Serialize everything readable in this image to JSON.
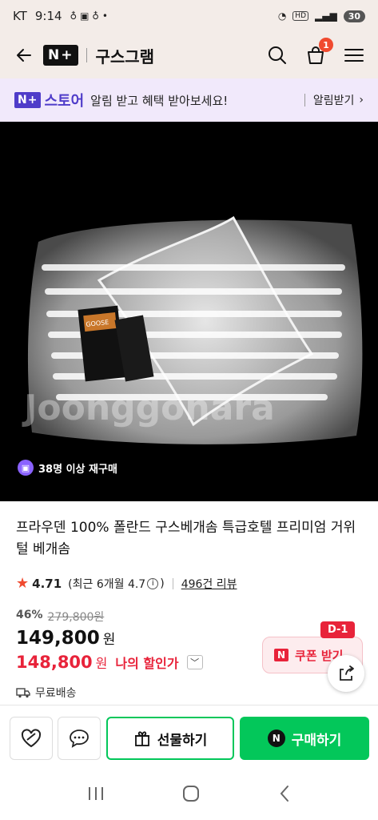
{
  "status_bar": {
    "carrier": "KT",
    "time": "9:14",
    "battery": "30"
  },
  "header": {
    "logo": "N+",
    "title": "구스그램",
    "cart_count": "1"
  },
  "notice": {
    "logo_mark": "N+",
    "logo_text": "스토어",
    "message": "알림 받고 혜택 받아보세요!",
    "action_label": "알림받기",
    "action_chevron": "›"
  },
  "hero": {
    "rebuy_text": "38명 이상 재구매",
    "watermark": "Joonggonara"
  },
  "product": {
    "title": "프라우덴 100% 폴란드 구스베개솜 특급호텔 프리미엄 거위털 베개솜",
    "rating": "4.71",
    "recent_rating_prefix": "(최근 6개월 4.7",
    "recent_rating_suffix": ")",
    "review_count": "496건 리뷰",
    "discount_pct": "46%",
    "original_price": "279,800원",
    "price": "149,800",
    "price_unit": "원",
    "my_discount_price": "148,800",
    "my_discount_unit": "원",
    "my_discount_label": "나의 할인가",
    "shipping": "무료배송"
  },
  "coupon": {
    "d_day": "D-1",
    "mark": "N",
    "label": "쿠폰 받기"
  },
  "actions": {
    "gift_label": "선물하기",
    "buy_label": "구매하기",
    "buy_mark": "N"
  },
  "colors": {
    "naver_green": "#03c75a",
    "accent_red": "#e8233a",
    "store_purple": "#4f3cc9",
    "header_bg": "#f3ece8"
  }
}
